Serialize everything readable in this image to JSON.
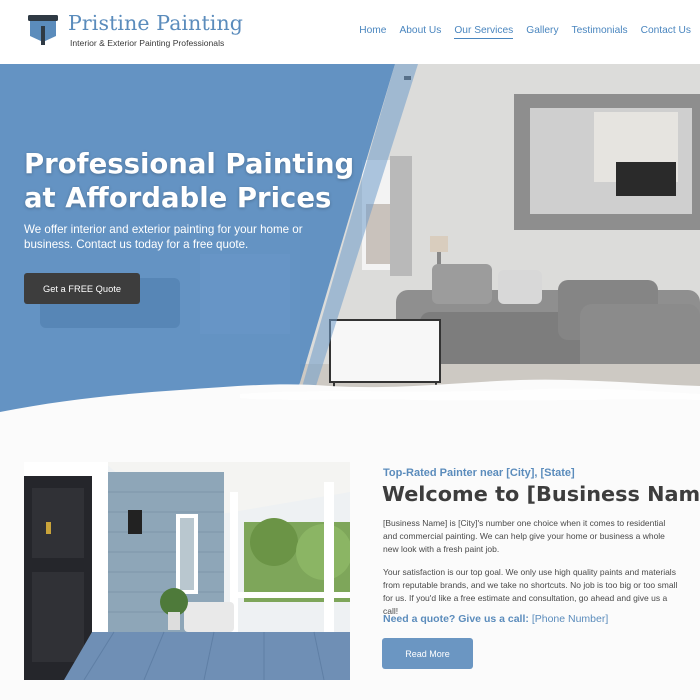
{
  "brand": {
    "name": "Pristine Painting",
    "tagline": "Interior & Exterior Painting Professionals",
    "logo_icon": "paint-roller-icon"
  },
  "nav": {
    "items": [
      {
        "label": "Home"
      },
      {
        "label": "About Us"
      },
      {
        "label": "Our Services"
      },
      {
        "label": "Gallery"
      },
      {
        "label": "Testimonials"
      },
      {
        "label": "Contact Us"
      }
    ]
  },
  "hero": {
    "title": "Professional Painting at Affordable Prices",
    "subtitle": "We offer interior and exterior painting for your home or business. Contact us today for a free quote.",
    "cta_label": "Get a FREE Quote"
  },
  "welcome": {
    "eyebrow": "Top-Rated Painter near [City], [State]",
    "title": "Welcome to [Business Name]",
    "paragraph_1": "[Business Name] is [City]'s number one choice when it comes to residential and commercial painting. We can help give your home or business a whole new look with a fresh paint job.",
    "paragraph_2": "Your satisfaction is our top goal. We only use high quality paints and materials from reputable brands, and we take no shortcuts. No job is too big or too small for us. If you'd like a free estimate and consultation, go ahead and give us a call!",
    "call_label": "Need a quote? Give us a call:",
    "call_phone": "[Phone Number]",
    "read_more_label": "Read More"
  },
  "colors": {
    "accent": "#5b8cbc",
    "hero_overlay": "#4f86be",
    "button_dark": "#3d3d3d",
    "button_blue": "#6b96c2"
  }
}
